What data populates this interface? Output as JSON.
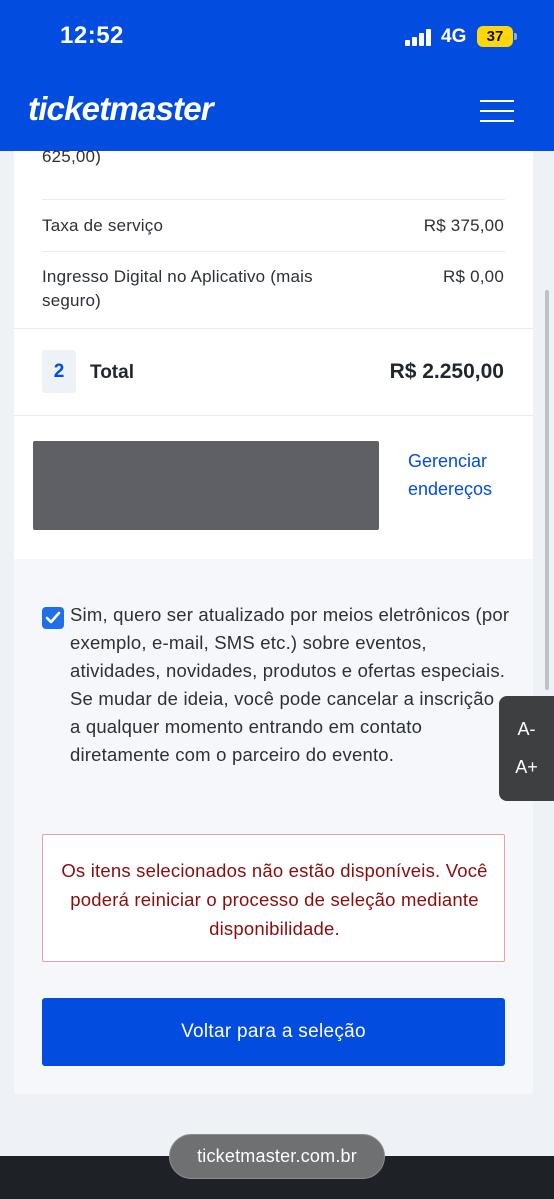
{
  "status_bar": {
    "time": "12:52",
    "network": "4G",
    "battery": "37"
  },
  "header": {
    "logo": "ticketmaster",
    "menu_icon": "hamburger-menu-icon"
  },
  "order": {
    "partial_line": "625,00)",
    "service_fee_label": "Taxa de serviço",
    "service_fee_value": "R$ 375,00",
    "digital_ticket_label": "Ingresso Digital no Aplicativo (mais seguro)",
    "digital_ticket_value": "R$ 0,00",
    "quantity": "2",
    "total_label": "Total",
    "total_value": "R$ 2.250,00"
  },
  "address": {
    "manage_link": "Gerenciar endereços"
  },
  "opt_in": {
    "checked": true,
    "text": "Sim, quero ser atualizado por meios eletrônicos (por exemplo, e-mail, SMS etc.) sobre eventos, atividades, novidades, produtos e ofertas especiais. Se mudar de ideia, você pode cancelar a inscrição a qualquer momento entrando em contato diretamente com o parceiro do evento."
  },
  "error": {
    "message": "Os itens selecionados não estão disponíveis. Você poderá reiniciar o processo de seleção mediante disponibilidade."
  },
  "actions": {
    "back_button": "Voltar para a seleção"
  },
  "font_controls": {
    "decrease": "A-",
    "increase": "A+"
  },
  "browser": {
    "url": "ticketmaster.com.br"
  },
  "colors": {
    "brand": "#024ddf",
    "error": "#8a0d0d",
    "battery": "#ffd60a"
  }
}
